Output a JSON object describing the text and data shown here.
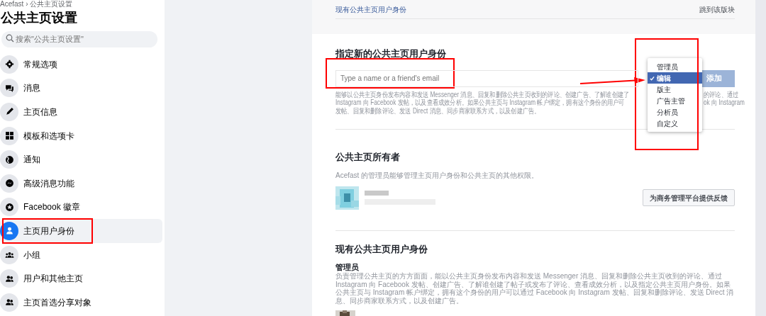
{
  "breadcrumb": "Acefast › 公共主页设置",
  "title": "公共主页设置",
  "search": {
    "placeholder": "搜索\"公共主页设置\""
  },
  "sidebar": {
    "items": [
      {
        "label": "常规选项",
        "selected": false
      },
      {
        "label": "消息",
        "selected": false
      },
      {
        "label": "主页信息",
        "selected": false
      },
      {
        "label": "模板和选项卡",
        "selected": false
      },
      {
        "label": "通知",
        "selected": false
      },
      {
        "label": "高级消息功能",
        "selected": false
      },
      {
        "label": "Facebook 徽章",
        "selected": false
      },
      {
        "label": "主页用户身份",
        "selected": true
      },
      {
        "label": "小组",
        "selected": false
      },
      {
        "label": "用户和其他主页",
        "selected": false
      },
      {
        "label": "主页首选分享对象",
        "selected": false
      }
    ]
  },
  "jump_bar": {
    "link": "现有公共主页用户身份",
    "action": "跳到该版块"
  },
  "assign": {
    "title": "指定新的公共主页用户身份",
    "input": {
      "placeholder": "Type a name or a friend's email"
    },
    "add_button": "添加",
    "role_menu": {
      "items": [
        {
          "label": "管理员",
          "selected": false
        },
        {
          "label": "编辑",
          "selected": true
        },
        {
          "label": "版主",
          "selected": false
        },
        {
          "label": "广告主管",
          "selected": false
        },
        {
          "label": "分析员",
          "selected": false
        },
        {
          "label": "自定义",
          "selected": false
        }
      ]
    },
    "description_lines": [
      {
        "left": "能够以公共主页身份发布内容和发送 Messenger 消息、回复和删除公共主页收到的评论、创建广告、了解谁创建了",
        "right": "的评论、通过"
      },
      {
        "left": "Instagram 向 Facebook 发帖，以及查看成效分析。如果公共主页与 Instagram 帐户绑定，拥有这个身份的用户可",
        "right": "ok 向 Instagram"
      },
      {
        "left": "发帖、回复和删除评论、发送 Direct 消息、同步商家联系方式，以及创建广告。"
      }
    ]
  },
  "owner": {
    "title": "公共主页所有者",
    "text": "Acefast 的管理员能够管理主页用户身份和公共主页的其他权限。",
    "feedback_button": "为商务管理平台提供反馈"
  },
  "existing": {
    "title": "现有公共主页用户身份",
    "roles": [
      {
        "name": "管理员",
        "description": "负责管理公共主页的方方面面，能以公共主页身份发布内容和发送 Messenger 消息、回复和删除公共主页收到的评论、通过 Instagram 向 Facebook 发帖、创建广告、了解谁创建了帖子或发布了评论、查看成效分析，以及指定公共主页用户身份。如果公共主页与 Instagram 帐户绑定，拥有这个身份的用户可以通过 Facebook 向 Instagram 发帖、回复和删除评论、发送 Direct 消息、同步商家联系方式，以及创建广告。"
      }
    ]
  }
}
